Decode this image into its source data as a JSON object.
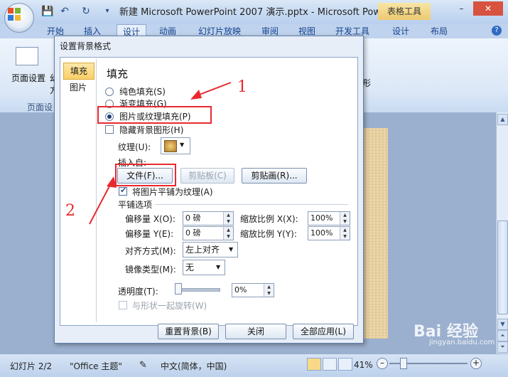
{
  "titlebar": {
    "title": "新建 Microsoft PowerPoint 2007 演示.pptx - Microsoft Powe...",
    "context_tab": "表格工具",
    "minimize": "–",
    "close": "✕"
  },
  "tabs": [
    "开始",
    "插入",
    "设计",
    "动画",
    "幻灯片放映",
    "审阅",
    "视图",
    "开发工具",
    "设计",
    "布局"
  ],
  "help": "?",
  "ribbon": {
    "page_setup": "页面设置",
    "partial_1": "幻",
    "partial_2": "方",
    "group_label": "页面设",
    "partial_right": "形"
  },
  "dialog": {
    "title": "设置背景格式",
    "nav": {
      "fill": "填充",
      "picture": "图片"
    },
    "heading": "填充",
    "options": {
      "solid": "纯色填充(S)",
      "gradient": "渐变填充(G)",
      "picture_texture": "图片或纹理填充(P)",
      "hide_bg": "隐藏背景图形(H)"
    },
    "texture_label": "纹理(U):",
    "insert_from": "插入自:",
    "buttons": {
      "file": "文件(F)...",
      "clipboard": "剪贴板(C)",
      "clipart": "剪贴画(R)..."
    },
    "tile_as_texture": "将图片平铺为纹理(A)",
    "tile_options": "平铺选项",
    "offset_x_label": "偏移量 X(O):",
    "offset_x": "0 磅",
    "offset_y_label": "偏移量 Y(E):",
    "offset_y": "0 磅",
    "scale_x_label": "缩放比例 X(X):",
    "scale_x": "100%",
    "scale_y_label": "缩放比例 Y(Y):",
    "scale_y": "100%",
    "align_label": "对齐方式(M):",
    "align_value": "左上对齐",
    "mirror_label": "镜像类型(M):",
    "mirror_value": "无",
    "transparency_label": "透明度(T):",
    "transparency": "0%",
    "rotate_with_shape": "与形状一起旋转(W)",
    "reset": "重置背景(B)",
    "close": "关闭",
    "apply_all": "全部应用(L)"
  },
  "annotations": {
    "one": "1",
    "two": "2"
  },
  "status": {
    "slide": "幻灯片 2/2",
    "theme": "\"Office 主题\"",
    "language": "中文(简体，中国)",
    "zoom": "41%",
    "watermark": "Bai 经验",
    "watermark_url": "jingyan.baidu.com"
  },
  "colors": {
    "annotation_red": "#e8292e",
    "selected_nav": "#f9cf66"
  }
}
